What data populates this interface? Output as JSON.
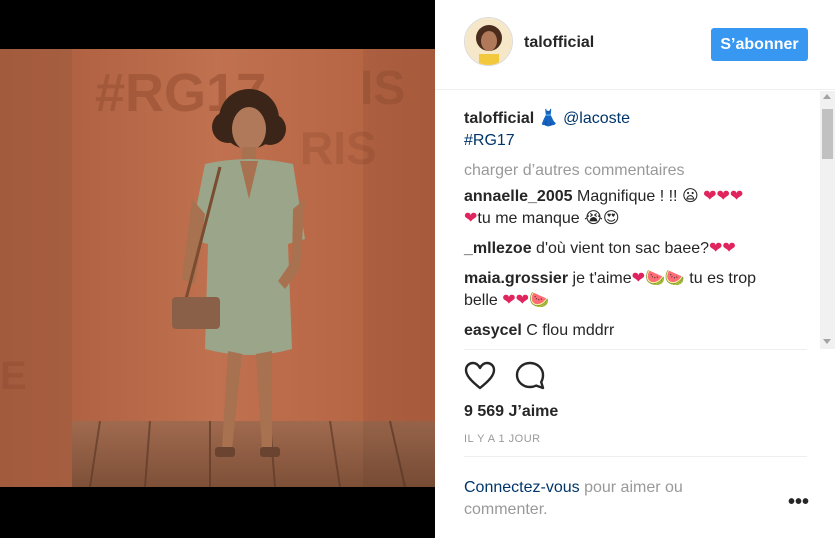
{
  "post": {
    "username": "talofficial",
    "follow_label": "S’abonner",
    "caption": {
      "user": "talofficial",
      "emoji": "dress-emoji",
      "mention": "@lacoste",
      "hashtag": "#RG17"
    },
    "load_more_label": "charger d’autres commentaires",
    "photo_wall_text": "#RG17",
    "comments": [
      {
        "user": "annaelle_2005",
        "text": "Magnifique ! !!",
        "text2": "tu me manque"
      },
      {
        "user": "_mllezoe",
        "text": "d'où vient ton sac baee?"
      },
      {
        "user": "maia.grossier",
        "text": "je t'aime",
        "text2": "tu es trop",
        "text3": "belle"
      },
      {
        "user": "easycel",
        "text": "C flou mddrr"
      }
    ],
    "likes": "9 569 J’aime",
    "time_ago": "IL Y A 1 JOUR",
    "login_prompt": {
      "link": "Connectez-vous",
      "rest": " pour aimer ou commenter."
    },
    "more_label": "•••"
  },
  "colors": {
    "accent": "#3897f0",
    "link": "#003569",
    "muted": "#999999",
    "heart": "#e0245e",
    "wall": "#b8684a"
  },
  "icons": {
    "like": "heart-outline-icon",
    "comment": "comment-bubble-icon",
    "more": "ellipsis-icon"
  }
}
